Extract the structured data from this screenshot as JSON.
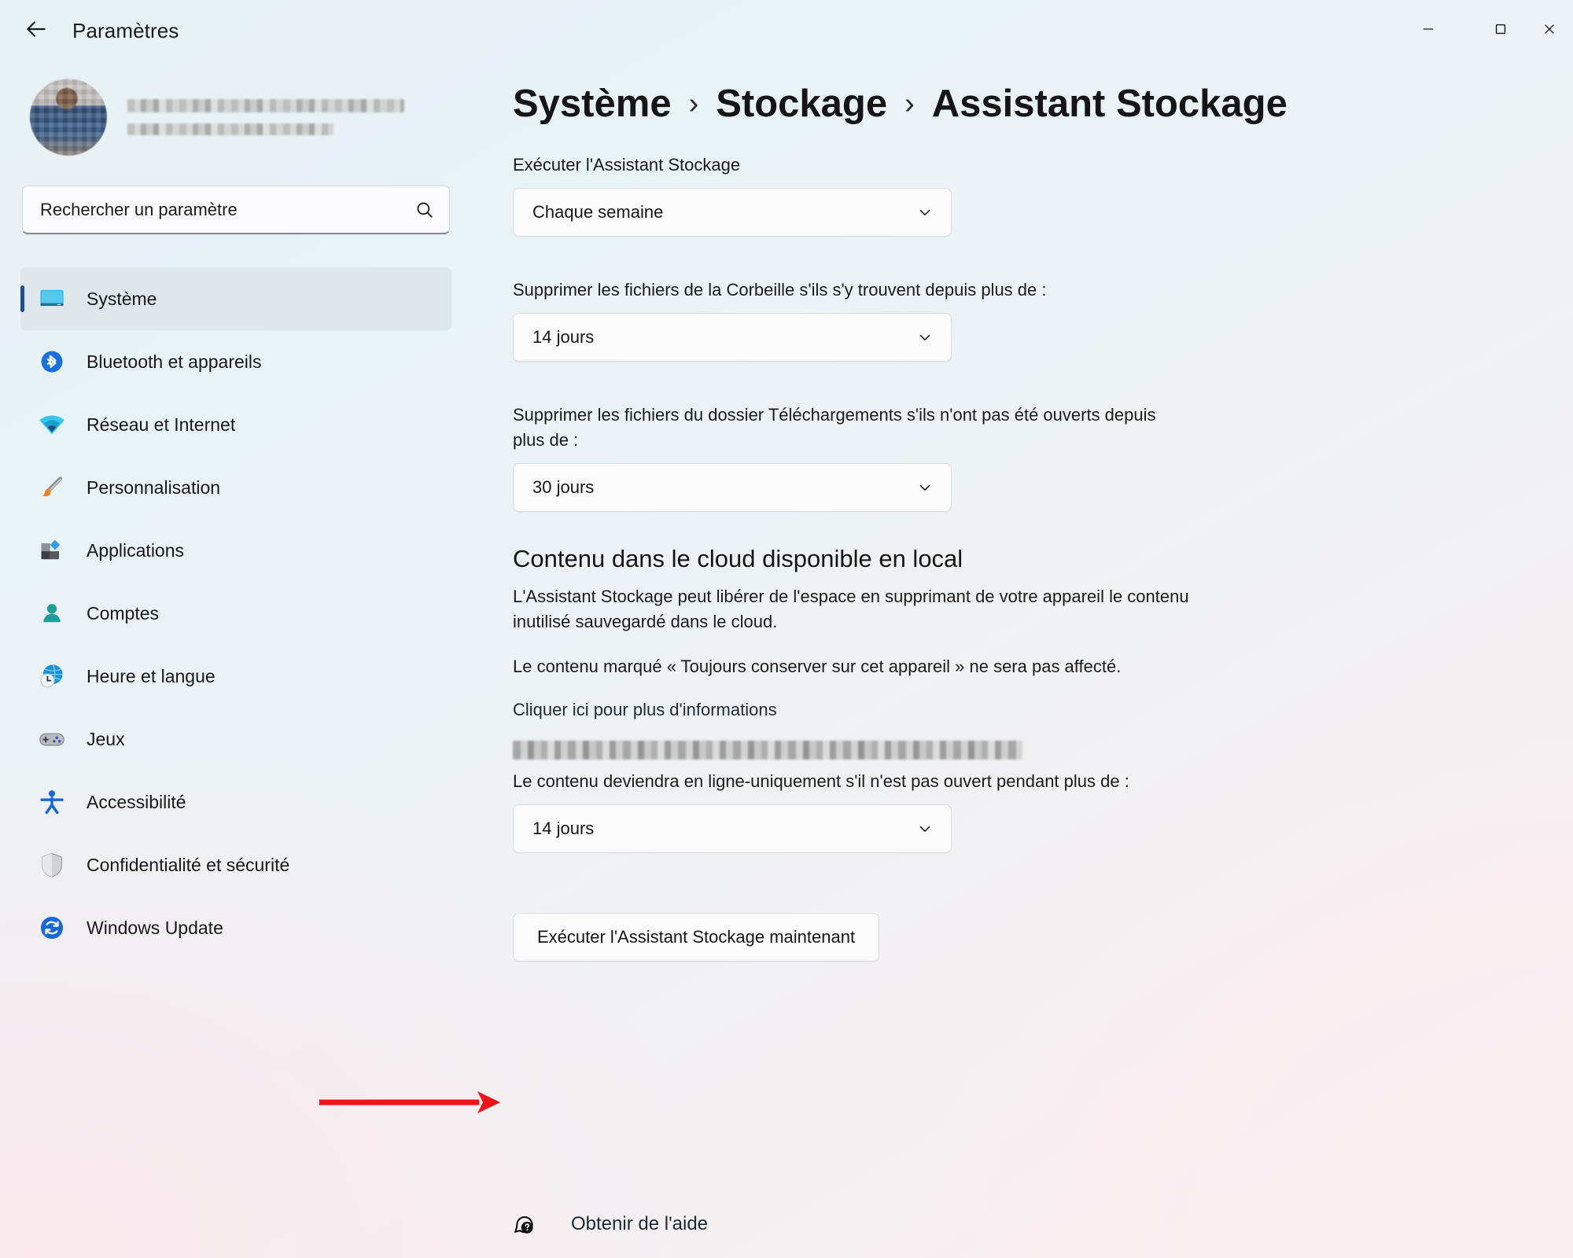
{
  "window": {
    "app_title": "Paramètres",
    "back_icon": "arrow-left-icon",
    "minimize_label": "–",
    "maximize_label": "□",
    "close_label": "✕"
  },
  "account": {
    "name_redacted": "Hermann Expert Mahougnon",
    "email_redacted": "hexpert2018@gmail.com",
    "avatar_icon": "user-avatar"
  },
  "search": {
    "placeholder": "Rechercher un paramètre",
    "icon": "search-icon"
  },
  "sidebar": {
    "items": [
      {
        "label": "Système",
        "icon": "monitor-icon",
        "active": true
      },
      {
        "label": "Bluetooth et appareils",
        "icon": "bluetooth-icon",
        "active": false
      },
      {
        "label": "Réseau et Internet",
        "icon": "wifi-icon",
        "active": false
      },
      {
        "label": "Personnalisation",
        "icon": "paintbrush-icon",
        "active": false
      },
      {
        "label": "Applications",
        "icon": "apps-icon",
        "active": false
      },
      {
        "label": "Comptes",
        "icon": "person-icon",
        "active": false
      },
      {
        "label": "Heure et langue",
        "icon": "clock-globe-icon",
        "active": false
      },
      {
        "label": "Jeux",
        "icon": "gamepad-icon",
        "active": false
      },
      {
        "label": "Accessibilité",
        "icon": "accessibility-icon",
        "active": false
      },
      {
        "label": "Confidentialité et sécurité",
        "icon": "shield-icon",
        "active": false
      },
      {
        "label": "Windows Update",
        "icon": "update-icon",
        "active": false
      }
    ]
  },
  "breadcrumb": {
    "crumb1": "Système",
    "sep1": "›",
    "crumb2": "Stockage",
    "sep2": "›",
    "crumb3": "Assistant Stockage"
  },
  "main": {
    "run_schedule_label": "Exécuter l'Assistant Stockage",
    "run_schedule_value": "Chaque semaine",
    "recycle_label": "Supprimer les fichiers de la Corbeille s'ils s'y trouvent depuis plus de :",
    "recycle_value": "14 jours",
    "downloads_label": "Supprimer les fichiers du dossier Téléchargements s'ils n'ont pas été ouverts depuis plus de :",
    "downloads_value": "30 jours",
    "cloud_section_title": "Contenu dans le cloud disponible en local",
    "cloud_para1": "L'Assistant Stockage peut libérer de l'espace en supprimant de votre appareil le contenu inutilisé sauvegardé dans le cloud.",
    "cloud_para2": "Le contenu marqué « Toujours conserver sur cet appareil » ne sera pas affecté.",
    "cloud_more_info_link": "Cliquer ici pour plus d'informations",
    "onedrive_account_redacted": "Hermann Expert Mahougnon : personnel",
    "online_only_label": "Le contenu deviendra en ligne-uniquement s'il n'est pas ouvert pendant plus de :",
    "online_only_value": "14 jours",
    "run_now_button": "Exécuter l'Assistant Stockage maintenant"
  },
  "footer": {
    "help_label": "Obtenir de l'aide",
    "help_icon": "help-question-bubble-icon"
  },
  "annotation": {
    "arrow_color": "#f4121a",
    "arrow_target": "run-storage-sense-now-button"
  },
  "colors": {
    "accent": "#1f4f8f",
    "bg_top_left": "#e7f2f5",
    "bg_bottom_right": "#faeef1",
    "text": "#1b1b1b"
  }
}
